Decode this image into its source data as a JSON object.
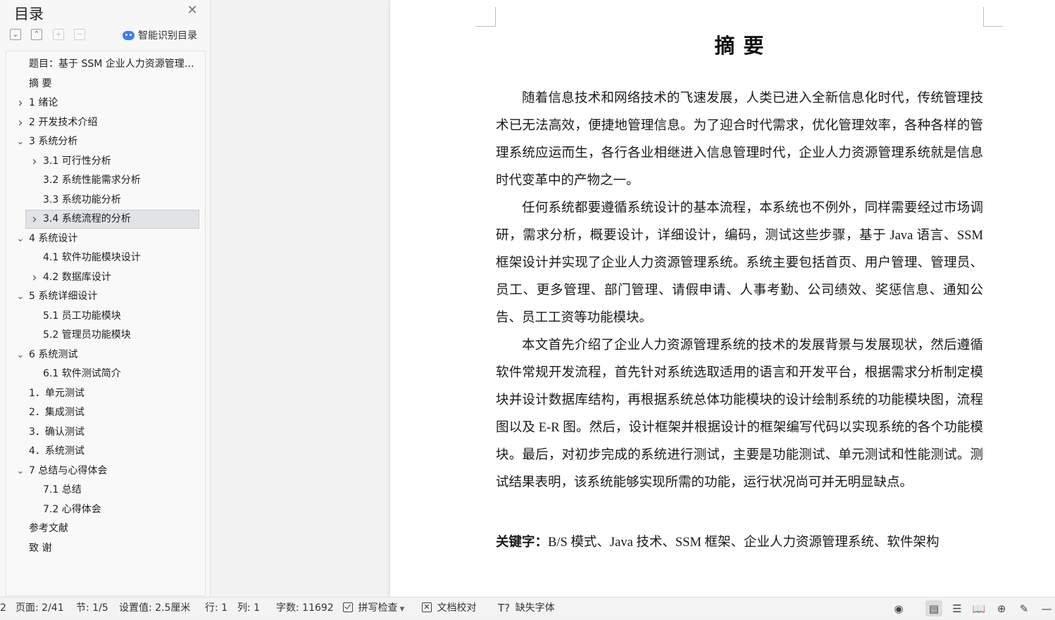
{
  "toc": {
    "title": "目录",
    "smart_toc_label": "智能识别目录",
    "items": [
      {
        "label": "题目：基于 SSM 企业人力资源管理系统的设计与实现",
        "level": 1,
        "arrow": "none",
        "selected": false
      },
      {
        "label": "摘    要",
        "level": 1,
        "arrow": "none",
        "selected": false
      },
      {
        "label": "1 绪论",
        "level": 1,
        "arrow": "right",
        "selected": false
      },
      {
        "label": "2 开发技术介绍",
        "level": 1,
        "arrow": "right",
        "selected": false
      },
      {
        "label": "3 系统分析",
        "level": 1,
        "arrow": "down",
        "selected": false
      },
      {
        "label": "3.1 可行性分析",
        "level": 2,
        "arrow": "right",
        "selected": false
      },
      {
        "label": "3.2 系统性能需求分析",
        "level": 2,
        "arrow": "none",
        "selected": false
      },
      {
        "label": "3.3 系统功能分析",
        "level": 2,
        "arrow": "none",
        "selected": false
      },
      {
        "label": "3.4 系统流程的分析",
        "level": 2,
        "arrow": "right",
        "selected": true
      },
      {
        "label": "4 系统设计",
        "level": 1,
        "arrow": "down",
        "selected": false
      },
      {
        "label": "4.1  软件功能模块设计",
        "level": 2,
        "arrow": "none",
        "selected": false
      },
      {
        "label": "4.2  数据库设计",
        "level": 2,
        "arrow": "right",
        "selected": false
      },
      {
        "label": "5 系统详细设计",
        "level": 1,
        "arrow": "down",
        "selected": false
      },
      {
        "label": "5.1 员工功能模块",
        "level": 2,
        "arrow": "none",
        "selected": false
      },
      {
        "label": "5.2 管理员功能模块",
        "level": 2,
        "arrow": "none",
        "selected": false
      },
      {
        "label": "6 系统测试",
        "level": 1,
        "arrow": "down",
        "selected": false
      },
      {
        "label": "6.1  软件测试简介",
        "level": 2,
        "arrow": "none",
        "selected": false
      },
      {
        "label": "1．单元测试",
        "level": 1,
        "arrow": "none",
        "selected": false
      },
      {
        "label": "2．集成测试",
        "level": 1,
        "arrow": "none",
        "selected": false
      },
      {
        "label": "3．确认测试",
        "level": 1,
        "arrow": "none",
        "selected": false
      },
      {
        "label": "4．系统测试",
        "level": 1,
        "arrow": "none",
        "selected": false
      },
      {
        "label": "7 总结与心得体会",
        "level": 1,
        "arrow": "down",
        "selected": false
      },
      {
        "label": "7.1  总结",
        "level": 2,
        "arrow": "none",
        "selected": false
      },
      {
        "label": "7.2  心得体会",
        "level": 2,
        "arrow": "none",
        "selected": false
      },
      {
        "label": "参考文献",
        "level": 1,
        "arrow": "none",
        "selected": false
      },
      {
        "label": "致  谢",
        "level": 1,
        "arrow": "none",
        "selected": false
      }
    ]
  },
  "document": {
    "heading": "摘    要",
    "paragraphs": [
      "随着信息技术和网络技术的飞速发展，人类已进入全新信息化时代，传统管理技术已无法高效，便捷地管理信息。为了迎合时代需求，优化管理效率，各种各样的管理系统应运而生，各行各业相继进入信息管理时代，企业人力资源管理系统就是信息时代变革中的产物之一。",
      "任何系统都要遵循系统设计的基本流程，本系统也不例外，同样需要经过市场调研，需求分析，概要设计，详细设计，编码，测试这些步骤，基于 Java 语言、SSM 框架设计并实现了企业人力资源管理系统。系统主要包括首页、用户管理、管理员、员工、更多管理、部门管理、请假申请、人事考勤、公司绩效、奖惩信息、通知公告、员工工资等功能模块。",
      "本文首先介绍了企业人力资源管理系统的技术的发展背景与发展现状，然后遵循软件常规开发流程，首先针对系统选取适用的语言和开发平台，根据需求分析制定模块并设计数据库结构，再根据系统总体功能模块的设计绘制系统的功能模块图，流程图以及 E-R 图。然后，设计框架并根据设计的框架编写代码以实现系统的各个功能模块。最后，对初步完成的系统进行测试，主要是功能测试、单元测试和性能测试。测试结果表明，该系统能够实现所需的功能，运行状况尚可并无明显缺点。"
    ],
    "keywords_label": "关键字：",
    "keywords_text": "B/S 模式、Java 技术、SSM 框架、企业人力资源管理系统、软件架构"
  },
  "status_bar": {
    "left_cut": "2",
    "page": "页面: 2/41",
    "section": "节: 1/5",
    "setting": "设置值: 2.5厘米",
    "row": "行: 1",
    "col": "列: 1",
    "word_count": "字数: 11692",
    "spell_check": "拼写检查",
    "doc_proof": "文档校对",
    "missing_font": "缺失字体"
  }
}
